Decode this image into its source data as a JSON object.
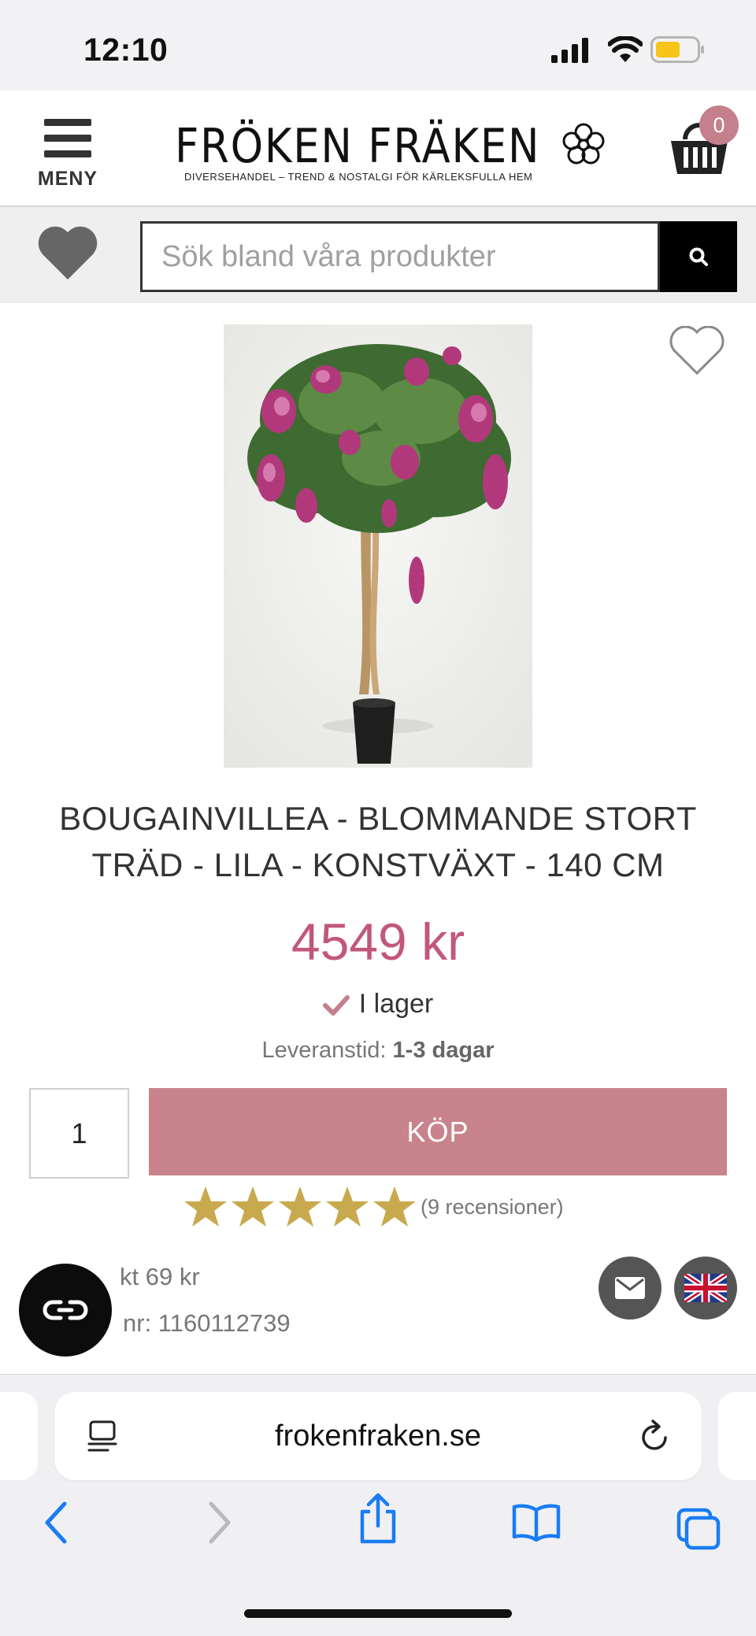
{
  "status_bar": {
    "time": "12:10"
  },
  "header": {
    "menu_label": "MENY",
    "logo_title": "FRÖKEN FRÄKEN",
    "logo_subtitle": "DIVERSEHANDEL – TREND & NOSTALGI FÖR KÄRLEKSFULLA HEM",
    "cart_count": "0"
  },
  "search": {
    "placeholder": "Sök bland våra produkter"
  },
  "product": {
    "title": "BOUGAINVILLEA - BLOMMANDE STORT TRÄD - LILA - KONSTVÄXT - 140 CM",
    "price": "4549 kr",
    "stock": "I lager",
    "delivery_label": "Leveranstid:",
    "delivery_value": "1-3 dagar",
    "quantity": "1",
    "buy_label": "KÖP",
    "rating": 5,
    "rating_max": 5,
    "reviews": "(9 recensioner)",
    "freight_partial": "kt 69 kr",
    "artnr_partial": "nr: 1160112739"
  },
  "browser": {
    "url": "frokenfraken.se"
  },
  "colors": {
    "accent": "#c4808b",
    "price": "#c2577b",
    "star": "#c9a94e",
    "ios_blue": "#1a7cf5"
  }
}
